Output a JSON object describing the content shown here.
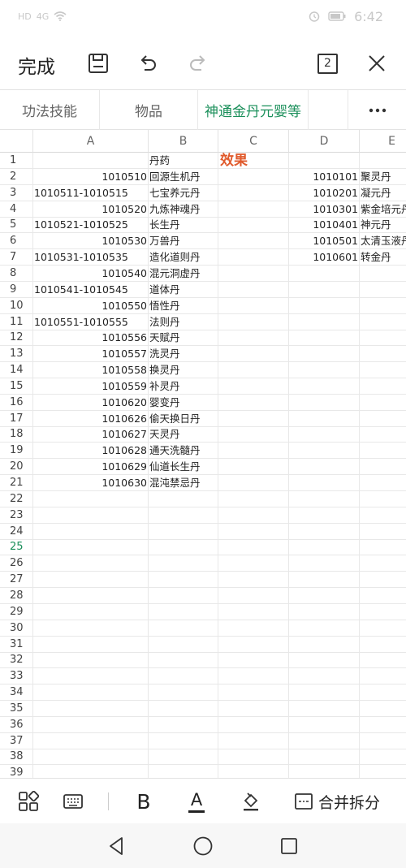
{
  "status": {
    "carrier": "HD",
    "signal": "4G",
    "battery": "",
    "time": "6:42"
  },
  "toolbar": {
    "done_label": "完成",
    "page_count": "2"
  },
  "tabs": [
    {
      "label": "功法技能"
    },
    {
      "label": "物品"
    },
    {
      "label": "神通金丹元婴等"
    }
  ],
  "columns": [
    "A",
    "B",
    "C",
    "D",
    "E"
  ],
  "rows": [
    {
      "n": "1",
      "a": "",
      "b": "丹药",
      "c": "效果",
      "d": "",
      "e": ""
    },
    {
      "n": "2",
      "a": "1010510",
      "b": "回源生机丹",
      "c": "",
      "d": "1010101",
      "e": "聚灵丹"
    },
    {
      "n": "3",
      "a": "1010511-1010515",
      "b": "七宝养元丹",
      "c": "",
      "d": "1010201",
      "e": "凝元丹"
    },
    {
      "n": "4",
      "a": "1010520",
      "b": "九炼神魂丹",
      "c": "",
      "d": "1010301",
      "e": "紫金培元丹"
    },
    {
      "n": "5",
      "a": "1010521-1010525",
      "b": "长生丹",
      "c": "",
      "d": "1010401",
      "e": "神元丹"
    },
    {
      "n": "6",
      "a": "1010530",
      "b": "万兽丹",
      "c": "",
      "d": "1010501",
      "e": "太清玉液丹"
    },
    {
      "n": "7",
      "a": "1010531-1010535",
      "b": "造化道则丹",
      "c": "",
      "d": "1010601",
      "e": "转金丹"
    },
    {
      "n": "8",
      "a": "1010540",
      "b": "混元洞虚丹",
      "c": "",
      "d": "",
      "e": ""
    },
    {
      "n": "9",
      "a": "1010541-1010545",
      "b": "道体丹",
      "c": "",
      "d": "",
      "e": ""
    },
    {
      "n": "10",
      "a": "1010550",
      "b": "悟性丹",
      "c": "",
      "d": "",
      "e": ""
    },
    {
      "n": "11",
      "a": "1010551-1010555",
      "b": "法则丹",
      "c": "",
      "d": "",
      "e": ""
    },
    {
      "n": "12",
      "a": "1010556",
      "b": "天赋丹",
      "c": "",
      "d": "",
      "e": ""
    },
    {
      "n": "13",
      "a": "1010557",
      "b": "洗灵丹",
      "c": "",
      "d": "",
      "e": ""
    },
    {
      "n": "14",
      "a": "1010558",
      "b": "换灵丹",
      "c": "",
      "d": "",
      "e": ""
    },
    {
      "n": "15",
      "a": "1010559",
      "b": "补灵丹",
      "c": "",
      "d": "",
      "e": ""
    },
    {
      "n": "16",
      "a": "1010620",
      "b": "婴变丹",
      "c": "",
      "d": "",
      "e": ""
    },
    {
      "n": "17",
      "a": "1010626",
      "b": "偷天换日丹",
      "c": "",
      "d": "",
      "e": ""
    },
    {
      "n": "18",
      "a": "1010627",
      "b": "天灵丹",
      "c": "",
      "d": "",
      "e": ""
    },
    {
      "n": "19",
      "a": "1010628",
      "b": "通天洗髓丹",
      "c": "",
      "d": "",
      "e": ""
    },
    {
      "n": "20",
      "a": "1010629",
      "b": "仙道长生丹",
      "c": "",
      "d": "",
      "e": ""
    },
    {
      "n": "21",
      "a": "1010630",
      "b": "混沌禁忌丹",
      "c": "",
      "d": "",
      "e": ""
    },
    {
      "n": "22",
      "a": "",
      "b": "",
      "c": "",
      "d": "",
      "e": ""
    },
    {
      "n": "23",
      "a": "",
      "b": "",
      "c": "",
      "d": "",
      "e": ""
    },
    {
      "n": "24",
      "a": "",
      "b": "",
      "c": "",
      "d": "",
      "e": ""
    },
    {
      "n": "25",
      "a": "",
      "b": "",
      "c": "",
      "d": "",
      "e": ""
    },
    {
      "n": "26",
      "a": "",
      "b": "",
      "c": "",
      "d": "",
      "e": ""
    },
    {
      "n": "27",
      "a": "",
      "b": "",
      "c": "",
      "d": "",
      "e": ""
    },
    {
      "n": "28",
      "a": "",
      "b": "",
      "c": "",
      "d": "",
      "e": ""
    },
    {
      "n": "29",
      "a": "",
      "b": "",
      "c": "",
      "d": "",
      "e": ""
    },
    {
      "n": "30",
      "a": "",
      "b": "",
      "c": "",
      "d": "",
      "e": ""
    },
    {
      "n": "31",
      "a": "",
      "b": "",
      "c": "",
      "d": "",
      "e": ""
    },
    {
      "n": "32",
      "a": "",
      "b": "",
      "c": "",
      "d": "",
      "e": ""
    },
    {
      "n": "33",
      "a": "",
      "b": "",
      "c": "",
      "d": "",
      "e": ""
    },
    {
      "n": "34",
      "a": "",
      "b": "",
      "c": "",
      "d": "",
      "e": ""
    },
    {
      "n": "35",
      "a": "",
      "b": "",
      "c": "",
      "d": "",
      "e": ""
    },
    {
      "n": "36",
      "a": "",
      "b": "",
      "c": "",
      "d": "",
      "e": ""
    },
    {
      "n": "37",
      "a": "",
      "b": "",
      "c": "",
      "d": "",
      "e": ""
    },
    {
      "n": "38",
      "a": "",
      "b": "",
      "c": "",
      "d": "",
      "e": ""
    },
    {
      "n": "39",
      "a": "",
      "b": "",
      "c": "",
      "d": "",
      "e": ""
    }
  ],
  "selected_row": "25",
  "edit_bar": {
    "bold_label": "B",
    "font_color_label": "A",
    "merge_label": "合并拆分"
  },
  "colors": {
    "accent": "#1a8f5a",
    "effect_header": "#e05a2c",
    "font_underline": "#222222"
  },
  "icons": [
    "save-icon",
    "undo-icon",
    "redo-icon",
    "close-icon",
    "more-icon",
    "apps-icon",
    "keyboard-icon",
    "fill-color-icon",
    "cell-border-icon",
    "back-icon",
    "home-icon",
    "recents-icon"
  ]
}
